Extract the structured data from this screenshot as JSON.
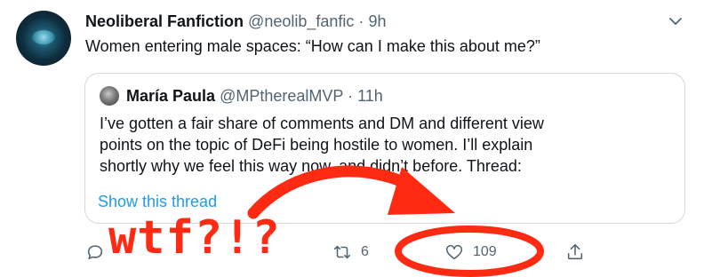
{
  "tweet": {
    "display_name": "Neoliberal Fanfiction",
    "handle": "@neolib_fanfic",
    "separator": "·",
    "time": "9h",
    "text": "Women entering male spaces: “How can I make this about me?”",
    "avatar_icon": "abstract-avatar"
  },
  "quote": {
    "display_name": "María Paula",
    "handle": "@MPtherealMVP",
    "separator": "·",
    "time": "11h",
    "lines": [
      "I’ve gotten a fair share of comments and DM and different view",
      "points on the topic of DeFi being hostile to women. I’ll explain",
      "shortly why we feel this way now, and didn’t before. Thread:"
    ],
    "show_thread": "Show this thread"
  },
  "actions": {
    "reply_icon": "reply-icon",
    "retweet_icon": "retweet-icon",
    "retweet_count": "6",
    "like_icon": "heart-icon",
    "like_count": "109",
    "share_icon": "share-icon"
  },
  "annotation": {
    "text": "wtf?!?",
    "color": "#ff2a12"
  },
  "colors": {
    "link": "#1d9bf0",
    "muted": "#536471",
    "text": "#0f1419",
    "border": "#cfd9de"
  }
}
